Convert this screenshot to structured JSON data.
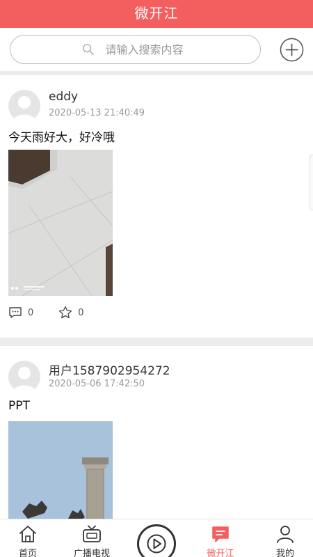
{
  "header": {
    "title": "微开江"
  },
  "search": {
    "placeholder": "请输入搜索内容"
  },
  "posts": [
    {
      "username": "eddy",
      "time": "2020-05-13 21:40:49",
      "content": "今天雨好大，好冷哦",
      "comments": "0",
      "likes": "0"
    },
    {
      "username": "用户1587902954272",
      "time": "2020-05-06 17:42:50",
      "content": "PPT"
    }
  ],
  "tabs": [
    {
      "label": "首页",
      "icon": "home-icon"
    },
    {
      "label": "广播电视",
      "icon": "tv-icon"
    },
    {
      "label": "",
      "icon": "play-icon"
    },
    {
      "label": "微开江",
      "icon": "message-icon"
    },
    {
      "label": "我的",
      "icon": "user-icon"
    }
  ],
  "colors": {
    "brand": "#f35f5f",
    "divider": "#ececec"
  }
}
